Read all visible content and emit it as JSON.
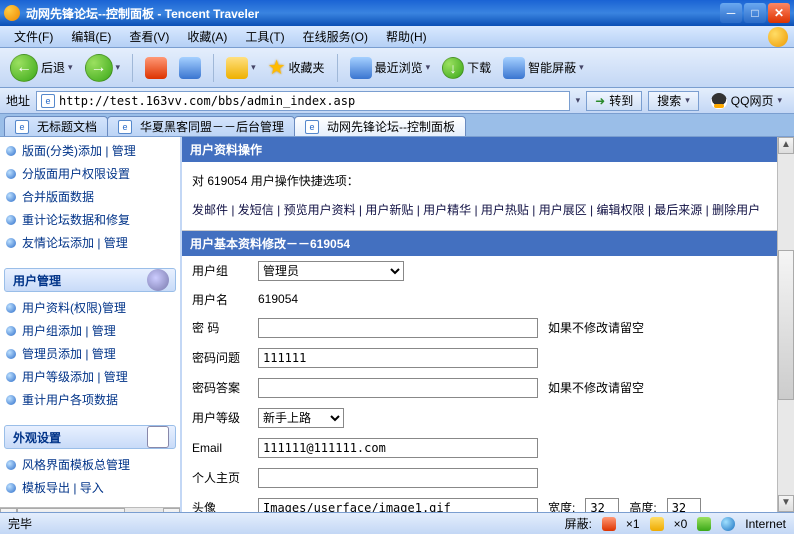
{
  "window": {
    "title": "动网先锋论坛--控制面板 - Tencent Traveler"
  },
  "menu": {
    "file": "文件(F)",
    "edit": "编辑(E)",
    "view": "查看(V)",
    "fav": "收藏(A)",
    "tool": "工具(T)",
    "online": "在线服务(O)",
    "help": "帮助(H)"
  },
  "toolbar": {
    "back": "后退",
    "favorites": "收藏夹",
    "recent": "最近浏览",
    "download": "下载",
    "smartblock": "智能屏蔽"
  },
  "address": {
    "label": "地址",
    "url": "http://test.163vv.com/bbs/admin_index.asp",
    "go": "转到",
    "search": "搜索",
    "qq": "QQ网页"
  },
  "tabs": [
    {
      "label": "无标题文档"
    },
    {
      "label": "华夏黑客同盟－－后台管理"
    },
    {
      "label": "动网先锋论坛--控制面板"
    }
  ],
  "sidebar": {
    "group1": [
      "版面(分类)添加 | 管理",
      "分版面用户权限设置",
      "合并版面数据",
      "重计论坛数据和修复",
      "友情论坛添加 | 管理"
    ],
    "section_user": "用户管理",
    "group2": [
      "用户资料(权限)管理",
      "用户组添加 | 管理",
      "管理员添加 | 管理",
      "用户等级添加 | 管理",
      "重计用户各项数据"
    ],
    "section_skin": "外观设置",
    "group3": [
      "风格界面模板总管理",
      "模板导出 | 导入"
    ]
  },
  "main": {
    "panel1": "用户资料操作",
    "quick_intro": "对 619054 用户操作快捷选项：",
    "quick_links": "发邮件 | 发短信 | 预览用户资料 | 用户新贴 | 用户精华 | 用户热贴 | 用户展区 | 编辑权限 | 最后来源 | 删除用户",
    "panel2": "用户基本资料修改－－619054",
    "labels": {
      "group": "用户组",
      "name": "用户名",
      "pwd": "密 码",
      "q": "密码问题",
      "a": "密码答案",
      "level": "用户等级",
      "email": "Email",
      "homepage": "个人主页",
      "avatar": "头像",
      "width": "宽度:",
      "height": "高度:"
    },
    "values": {
      "group": "管理员",
      "name": "619054",
      "pwd": "",
      "q": "111111",
      "a": "",
      "level": "新手上路",
      "email": "111111@111111.com",
      "homepage": "",
      "avatar": "Images/userface/image1.gif",
      "width": "32",
      "height": "32"
    },
    "notes": {
      "pwd": "如果不修改请留空",
      "a": "如果不修改请留空"
    }
  },
  "status": {
    "done": "完毕",
    "block": "屏蔽:",
    "x1": "×1",
    "x0": "×0",
    "net": "Internet"
  }
}
